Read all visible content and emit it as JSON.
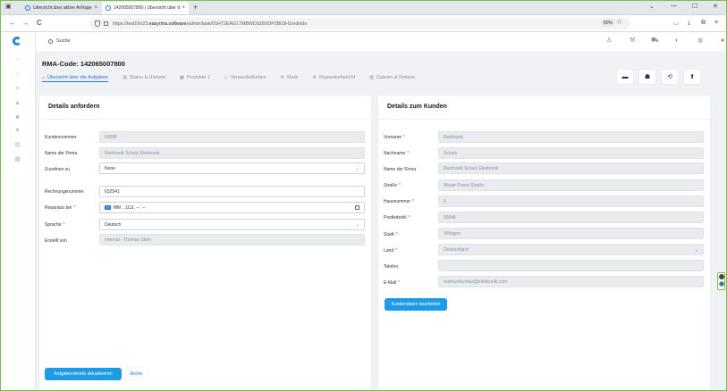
{
  "browser": {
    "tabs": [
      {
        "label": "Übersicht über aktive Anfragen",
        "close": "×"
      },
      {
        "label": "142065007800 | Übersicht über d",
        "close": "×"
      }
    ],
    "new_tab": "+",
    "url_prefix": "https://test16n23.",
    "url_domain": "easyrma.software",
    "url_path": "/admin/task/01HT2EAG17MBWD9Z8XDP2B03H1/edit/de",
    "zoom": "80%",
    "back": "←",
    "forward": "→",
    "reload": "C",
    "star": "☆",
    "win_min": "—",
    "win_max": "☐",
    "win_close": "✕",
    "win_chev": "⌄"
  },
  "app": {
    "search_placeholder": "Suche",
    "rma_title": "RMA-Code: 142065007800",
    "tabs": [
      {
        "label": "Übersicht über die Aufgaben",
        "icon": "home-icon"
      },
      {
        "label": "Status & Historie",
        "icon": "history-icon"
      },
      {
        "label": "Produkte  1",
        "icon": "box-icon"
      },
      {
        "label": "Versandetiketten",
        "icon": "tag-icon"
      },
      {
        "label": "Mails",
        "icon": "mail-icon"
      },
      {
        "label": "Reparaturbericht",
        "icon": "report-icon"
      },
      {
        "label": "Dateien & Notizen",
        "icon": "files-icon"
      }
    ]
  },
  "left_card": {
    "title": "Details anfordern",
    "fields": [
      {
        "label": "Kundennummer",
        "value": "69585",
        "required": false
      },
      {
        "label": "Name der Firma",
        "value": "Reinhardt Schulz Elektronik",
        "required": false
      },
      {
        "label": "Zuordnen zu",
        "value": "None",
        "required": false
      },
      {
        "label": "Rechnungsnummer",
        "value": "632541",
        "required": false
      },
      {
        "label": "Reparatur bei",
        "value": "MM . JJJJ, -- : --",
        "required": true
      },
      {
        "label": "Sprache",
        "value": "Deutsch",
        "required": true
      },
      {
        "label": "Erstellt von",
        "value": "Internal - Thomas Stein",
        "required": false
      }
    ],
    "required_mark": "*",
    "date_tt": "TT",
    "primary_button": "Aufgabendetails aktualisieren",
    "secondary_button": "Archiv"
  },
  "right_card": {
    "title": "Details zum Kunden",
    "fields": [
      {
        "label": "Vorname",
        "value": "Reinhardt",
        "required": true
      },
      {
        "label": "Nachname",
        "value": "Schulz",
        "required": true
      },
      {
        "label": "Name der Firma",
        "value": "Reinhardt Schulz Elektronik",
        "required": false
      },
      {
        "label": "Straße",
        "value": "Meyer-Franz-Straße",
        "required": true
      },
      {
        "label": "Hausnummer",
        "value": "5",
        "required": true
      },
      {
        "label": "Postleitzahl",
        "value": "55846",
        "required": true
      },
      {
        "label": "Stadt",
        "value": "Villingen",
        "required": true
      },
      {
        "label": "Land",
        "value": "Deutschland",
        "required": true
      },
      {
        "label": "Telefon",
        "value": "",
        "required": false
      },
      {
        "label": "E-Mail",
        "value": "reinhardtschulz@elektronik.com",
        "required": true
      }
    ],
    "required_mark": "*",
    "edit_button": "Kundendaten bearbeiten"
  },
  "colors": {
    "accent": "#1a73e8",
    "button": "#1e9be6",
    "required": "#e53935"
  }
}
